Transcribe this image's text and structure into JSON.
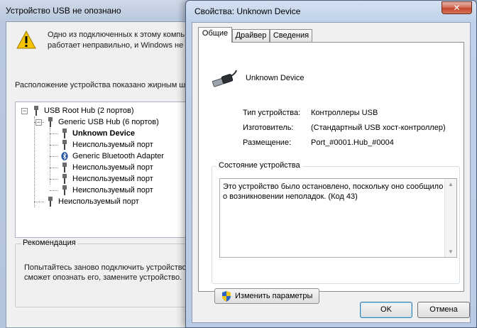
{
  "usb_window": {
    "title": "Устройство USB не опознано",
    "warning_text_line1": "Одно из подключенных к этому компь",
    "warning_text_line2": "работает неправильно, и Windows не у",
    "location_text": "Расположение устройства показано жирным ш",
    "tree": [
      {
        "label": "USB Root Hub (2 портов)",
        "bold": false,
        "icon": "usb-plug-icon"
      },
      {
        "label": "Generic USB Hub (6 портов)",
        "bold": false,
        "icon": "usb-plug-icon"
      },
      {
        "label": "Unknown Device",
        "bold": true,
        "icon": "usb-plug-icon"
      },
      {
        "label": "Неиспользуемый порт",
        "bold": false,
        "icon": "usb-plug-icon"
      },
      {
        "label": "Generic Bluetooth Adapter",
        "bold": false,
        "icon": "bluetooth-icon"
      },
      {
        "label": "Неиспользуемый порт",
        "bold": false,
        "icon": "usb-plug-icon"
      },
      {
        "label": "Неиспользуемый порт",
        "bold": false,
        "icon": "usb-plug-icon"
      },
      {
        "label": "Неиспользуемый порт",
        "bold": false,
        "icon": "usb-plug-icon"
      },
      {
        "label": "Неиспользуемый порт",
        "bold": false,
        "icon": "usb-plug-icon"
      }
    ],
    "recommendation": {
      "title": "Рекомендация",
      "line1": "Попытайтесь заново подключить устройство",
      "line2": "сможет опознать его, замените устройство."
    }
  },
  "properties_dialog": {
    "title": "Свойства: Unknown Device",
    "close_label": "✕",
    "tabs": [
      {
        "label": "Общие",
        "active": true
      },
      {
        "label": "Драйвер",
        "active": false
      },
      {
        "label": "Сведения",
        "active": false
      }
    ],
    "device_name": "Unknown Device",
    "properties": [
      {
        "label": "Тип устройства:",
        "value": "Контроллеры USB"
      },
      {
        "label": "Изготовитель:",
        "value": "(Стандартный USB хост-контроллер)"
      },
      {
        "label": "Размещение:",
        "value": "Port_#0001.Hub_#0004"
      }
    ],
    "status_group_title": "Состояние устройства",
    "status_text": "Это устройство было остановлено, поскольку оно сообщило о возникновении неполадок. (Код 43)",
    "change_settings_label": "Изменить параметры",
    "ok_label": "OK",
    "cancel_label": "Отмена"
  }
}
